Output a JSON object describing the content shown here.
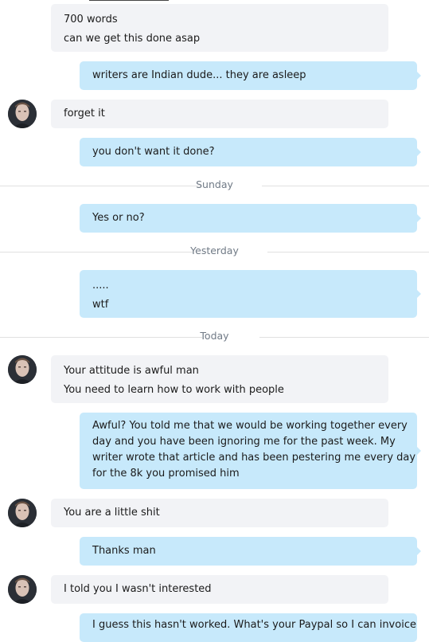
{
  "messages": {
    "m1": {
      "lines": [
        "700 words",
        "can we get this done asap"
      ]
    },
    "m2": {
      "lines": [
        "writers are Indian dude... they are asleep"
      ]
    },
    "m3": {
      "lines": [
        "forget it"
      ]
    },
    "m4": {
      "lines": [
        "you don't want it done?"
      ]
    },
    "m5": {
      "lines": [
        "Yes or no?"
      ]
    },
    "m6": {
      "lines": [
        ".....",
        "wtf"
      ]
    },
    "m7": {
      "lines": [
        "Your attitude is awful man",
        "You need to learn how to work with people"
      ]
    },
    "m8": {
      "lines": [
        "Awful? You told me that we would be working together every",
        "day and you have been ignoring me for the past week. My",
        "writer wrote that article and has been pestering me every day",
        "for the 8k you promised him"
      ]
    },
    "m9": {
      "lines": [
        "You are a little shit"
      ]
    },
    "m10": {
      "lines": [
        "Thanks man"
      ]
    },
    "m11": {
      "lines": [
        "I told you I wasn't interested"
      ]
    },
    "m12": {
      "lines": [
        "I guess this hasn't worked. What's your Paypal so I can invoice"
      ]
    }
  },
  "dividers": {
    "d1": "Sunday",
    "d2": "Yesterday",
    "d3": "Today"
  },
  "colors": {
    "incoming_bubble": "#f2f3f6",
    "outgoing_bubble": "#c7e9fb",
    "divider_text": "#707a86"
  },
  "icons": {
    "avatar": "contact-avatar"
  }
}
